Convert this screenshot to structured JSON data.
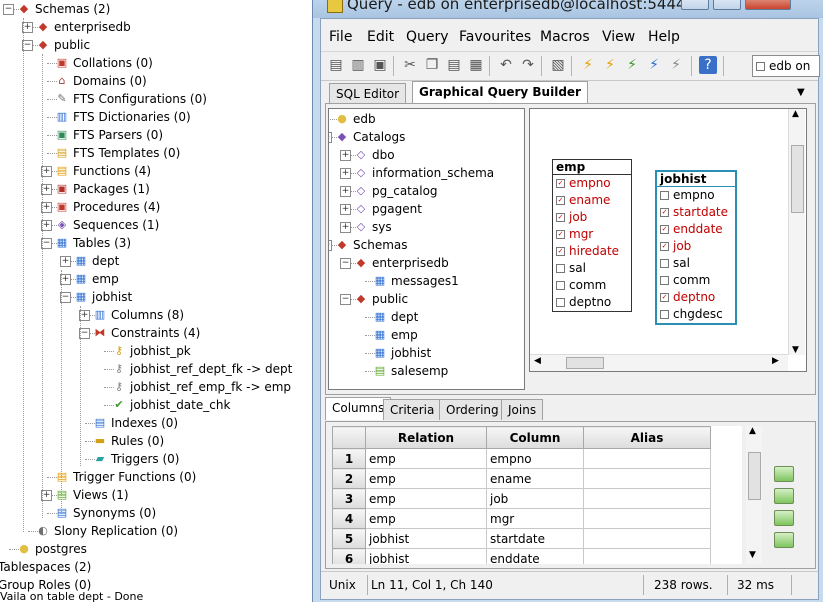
{
  "browser": {
    "tree": [
      {
        "label": "Schemas (2)",
        "icon": "schemas-icon",
        "color": "#c0392b",
        "indent": 0,
        "expander": "-"
      },
      {
        "label": "enterprisedb",
        "icon": "schema-icon",
        "color": "#c0392b",
        "indent": 1,
        "expander": "+"
      },
      {
        "label": "public",
        "icon": "schema-icon",
        "color": "#c0392b",
        "indent": 1,
        "expander": "-"
      },
      {
        "label": "Collations (0)",
        "icon": "collation-icon",
        "color": "#c0392b",
        "indent": 2,
        "expander": ""
      },
      {
        "label": "Domains (0)",
        "icon": "domain-icon",
        "color": "#a04040",
        "indent": 2,
        "expander": ""
      },
      {
        "label": "FTS Configurations (0)",
        "icon": "fts-config-icon",
        "color": "#707070",
        "indent": 2,
        "expander": ""
      },
      {
        "label": "FTS Dictionaries (0)",
        "icon": "fts-dictionary-icon",
        "color": "#2d6fd1",
        "indent": 2,
        "expander": ""
      },
      {
        "label": "FTS Parsers (0)",
        "icon": "fts-parser-icon",
        "color": "#2e8b57",
        "indent": 2,
        "expander": ""
      },
      {
        "label": "FTS Templates (0)",
        "icon": "fts-template-icon",
        "color": "#d4a017",
        "indent": 2,
        "expander": ""
      },
      {
        "label": "Functions (4)",
        "icon": "functions-icon",
        "color": "#e69a00",
        "indent": 2,
        "expander": "+"
      },
      {
        "label": "Packages (1)",
        "icon": "packages-icon",
        "color": "#b0302c",
        "indent": 2,
        "expander": "+"
      },
      {
        "label": "Procedures (4)",
        "icon": "procedures-icon",
        "color": "#c0392b",
        "indent": 2,
        "expander": "+"
      },
      {
        "label": "Sequences (1)",
        "icon": "sequences-icon",
        "color": "#7a52b3",
        "indent": 2,
        "expander": "+"
      },
      {
        "label": "Tables (3)",
        "icon": "tables-icon",
        "color": "#2d6fd1",
        "indent": 2,
        "expander": "-"
      },
      {
        "label": "dept",
        "icon": "table-icon",
        "color": "#2d6fd1",
        "indent": 3,
        "expander": "+"
      },
      {
        "label": "emp",
        "icon": "table-icon",
        "color": "#2d6fd1",
        "indent": 3,
        "expander": "+"
      },
      {
        "label": "jobhist",
        "icon": "table-icon",
        "color": "#2d6fd1",
        "indent": 3,
        "expander": "-"
      },
      {
        "label": "Columns (8)",
        "icon": "columns-icon",
        "color": "#2d6fd1",
        "indent": 4,
        "expander": "+"
      },
      {
        "label": "Constraints (4)",
        "icon": "constraints-icon",
        "color": "#c0392b",
        "indent": 4,
        "expander": "-"
      },
      {
        "label": "jobhist_pk",
        "icon": "key-icon",
        "color": "#d4a017",
        "indent": 5,
        "expander": ""
      },
      {
        "label": "jobhist_ref_dept_fk -> dept",
        "icon": "foreign-key-icon",
        "color": "#808080",
        "indent": 5,
        "expander": ""
      },
      {
        "label": "jobhist_ref_emp_fk -> emp",
        "icon": "foreign-key-icon",
        "color": "#808080",
        "indent": 5,
        "expander": ""
      },
      {
        "label": "jobhist_date_chk",
        "icon": "check-icon",
        "color": "#3a9a2a",
        "indent": 5,
        "expander": ""
      },
      {
        "label": "Indexes (0)",
        "icon": "indexes-icon",
        "color": "#2d6fd1",
        "indent": 4,
        "expander": ""
      },
      {
        "label": "Rules (0)",
        "icon": "rules-icon",
        "color": "#d4a017",
        "indent": 4,
        "expander": ""
      },
      {
        "label": "Triggers (0)",
        "icon": "triggers-icon",
        "color": "#2aa0a0",
        "indent": 4,
        "expander": ""
      },
      {
        "label": "Trigger Functions (0)",
        "icon": "trigger-functions-icon",
        "color": "#e69a00",
        "indent": 2,
        "expander": ""
      },
      {
        "label": "Views (1)",
        "icon": "views-icon",
        "color": "#5ba829",
        "indent": 2,
        "expander": "+"
      },
      {
        "label": "Synonyms (0)",
        "icon": "synonyms-icon",
        "color": "#2d6fd1",
        "indent": 2,
        "expander": ""
      },
      {
        "label": "Slony Replication (0)",
        "icon": "slony-icon",
        "color": "#707070",
        "indent": 1,
        "expander": ""
      },
      {
        "label": "postgres",
        "icon": "database-icon",
        "color": "#e0c040",
        "indent": 0,
        "expander": ""
      },
      {
        "label": "Tablespaces (2)",
        "icon": "",
        "color": "#000",
        "indent": -1,
        "expander": ""
      },
      {
        "label": "Group Roles (0)",
        "icon": "",
        "color": "#000",
        "indent": -1,
        "expander": ""
      }
    ],
    "status_text": "Vaila on table dept - Done"
  },
  "window": {
    "title": "Query - edb on enterprisedb@localhost:5444 *"
  },
  "menu": [
    "File",
    "Edit",
    "Query",
    "Favourites",
    "Macros",
    "View",
    "Help"
  ],
  "toolbar": {
    "connection": "edb on"
  },
  "tabs": {
    "sql_editor": "SQL Editor",
    "gqb": "Graphical Query Builder"
  },
  "qtree": [
    {
      "label": "edb",
      "icon": "database-icon",
      "color": "#e0c040",
      "indent": 0,
      "expander": ""
    },
    {
      "label": "Catalogs",
      "icon": "catalogs-icon",
      "color": "#7a52b3",
      "indent": 0,
      "expander": "-"
    },
    {
      "label": "dbo",
      "icon": "catalog-icon",
      "color": "#7a52b3",
      "indent": 1,
      "expander": "+"
    },
    {
      "label": "information_schema",
      "icon": "catalog-icon",
      "color": "#7a52b3",
      "indent": 1,
      "expander": "+"
    },
    {
      "label": "pg_catalog",
      "icon": "catalog-icon",
      "color": "#7a52b3",
      "indent": 1,
      "expander": "+"
    },
    {
      "label": "pgagent",
      "icon": "catalog-icon",
      "color": "#7a52b3",
      "indent": 1,
      "expander": "+"
    },
    {
      "label": "sys",
      "icon": "catalog-icon",
      "color": "#7a52b3",
      "indent": 1,
      "expander": "+"
    },
    {
      "label": "Schemas",
      "icon": "schemas-icon",
      "color": "#c0392b",
      "indent": 0,
      "expander": "-"
    },
    {
      "label": "enterprisedb",
      "icon": "schema-icon",
      "color": "#c0392b",
      "indent": 1,
      "expander": "-"
    },
    {
      "label": "messages1",
      "icon": "table-icon",
      "color": "#2d6fd1",
      "indent": 2,
      "expander": ""
    },
    {
      "label": "public",
      "icon": "schema-icon",
      "color": "#c0392b",
      "indent": 1,
      "expander": "-"
    },
    {
      "label": "dept",
      "icon": "table-icon",
      "color": "#2d6fd1",
      "indent": 2,
      "expander": ""
    },
    {
      "label": "emp",
      "icon": "table-icon",
      "color": "#2d6fd1",
      "indent": 2,
      "expander": ""
    },
    {
      "label": "jobhist",
      "icon": "table-icon",
      "color": "#2d6fd1",
      "indent": 2,
      "expander": ""
    },
    {
      "label": "salesemp",
      "icon": "view-icon",
      "color": "#5ba829",
      "indent": 2,
      "expander": ""
    }
  ],
  "canvas_tables": [
    {
      "name": "emp",
      "columns": [
        {
          "name": "empno",
          "checked": true
        },
        {
          "name": "ename",
          "checked": true
        },
        {
          "name": "job",
          "checked": true
        },
        {
          "name": "mgr",
          "checked": true
        },
        {
          "name": "hiredate",
          "checked": true
        },
        {
          "name": "sal",
          "checked": false
        },
        {
          "name": "comm",
          "checked": false
        },
        {
          "name": "deptno",
          "checked": false
        }
      ]
    },
    {
      "name": "jobhist",
      "columns": [
        {
          "name": "empno",
          "checked": false
        },
        {
          "name": "startdate",
          "checked": true
        },
        {
          "name": "enddate",
          "checked": true
        },
        {
          "name": "job",
          "checked": true
        },
        {
          "name": "sal",
          "checked": false
        },
        {
          "name": "comm",
          "checked": false
        },
        {
          "name": "deptno",
          "checked": true
        },
        {
          "name": "chgdesc",
          "checked": false
        }
      ]
    }
  ],
  "lower_tabs": [
    "Columns",
    "Criteria",
    "Ordering",
    "Joins"
  ],
  "grid": {
    "headers": [
      "Relation",
      "Column",
      "Alias"
    ],
    "rows": [
      {
        "n": "1",
        "relation": "emp",
        "column": "empno",
        "alias": ""
      },
      {
        "n": "2",
        "relation": "emp",
        "column": "ename",
        "alias": ""
      },
      {
        "n": "3",
        "relation": "emp",
        "column": "job",
        "alias": ""
      },
      {
        "n": "4",
        "relation": "emp",
        "column": "mgr",
        "alias": ""
      },
      {
        "n": "5",
        "relation": "jobhist",
        "column": "startdate",
        "alias": ""
      },
      {
        "n": "6",
        "relation": "jobhist",
        "column": "enddate",
        "alias": ""
      }
    ]
  },
  "status": {
    "mode": "Unix",
    "position": "Ln 11, Col 1, Ch 140",
    "rows": "238 rows.",
    "time": "32 ms"
  }
}
